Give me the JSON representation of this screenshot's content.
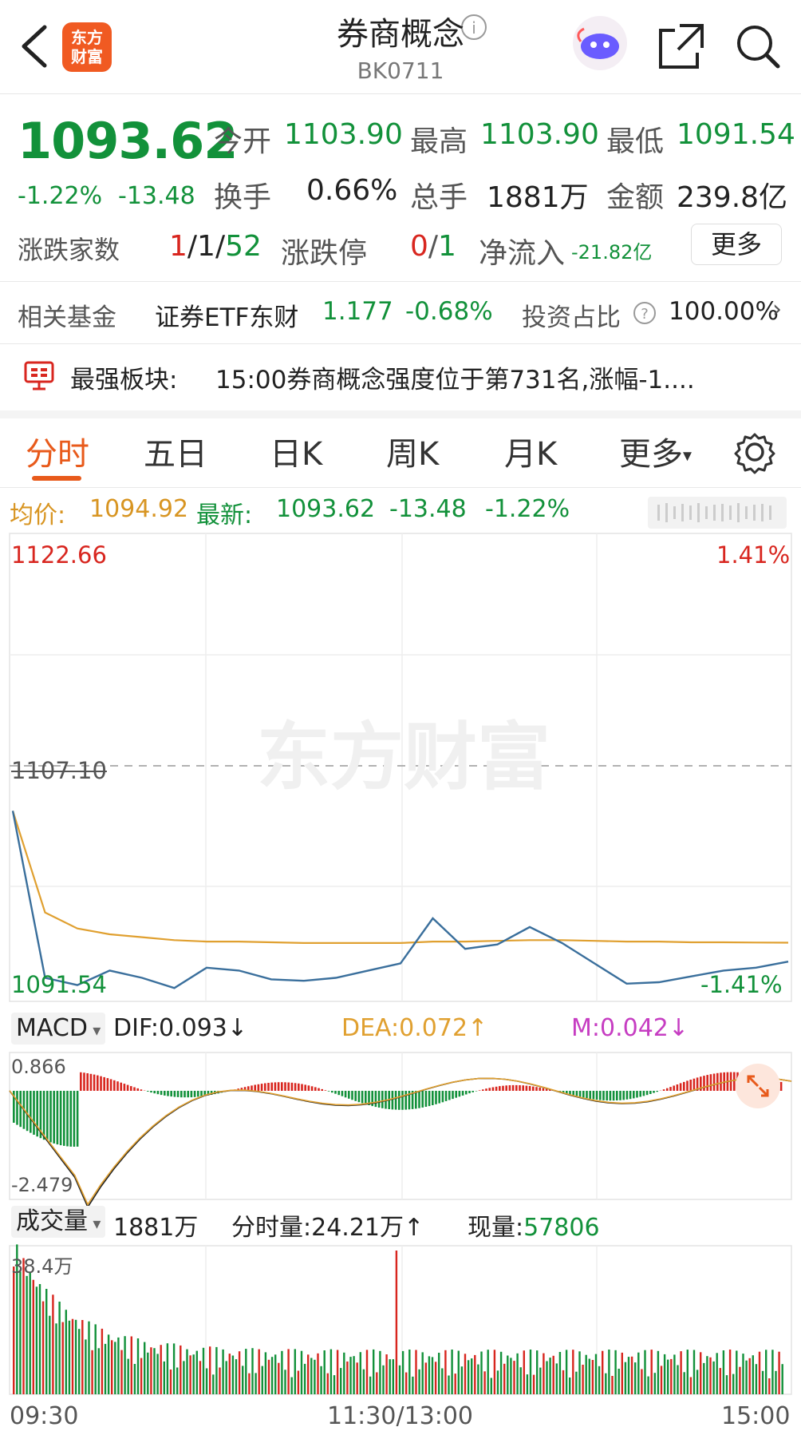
{
  "header": {
    "title": "券商概念",
    "code": "BK0711",
    "logo_text": "东方\n财富",
    "logo_line1": "东方",
    "logo_line2": "财富",
    "icons": [
      "back-icon",
      "info-icon",
      "robot-icon",
      "share-icon",
      "search-icon"
    ]
  },
  "quote": {
    "price": "1093.62",
    "change_pct": "-1.22%",
    "change": "-13.48",
    "open_label": "今开",
    "open": "1103.90",
    "high_label": "最高",
    "high": "1103.90",
    "low_label": "最低",
    "low": "1091.54",
    "turnover_label": "换手",
    "turnover": "0.66%",
    "volume_label": "总手",
    "volume": "1881万",
    "amount_label": "金额",
    "amount": "239.8亿",
    "breadth_label": "涨跌家数",
    "breadth_up": "1",
    "breadth_flat": "1",
    "breadth_down": "52",
    "limit_label": "涨跌停",
    "limit_up": "0",
    "limit_down": "1",
    "netflow_label": "净流入",
    "netflow": "-21.82亿",
    "more_label": "更多"
  },
  "fund": {
    "label": "相关基金",
    "name": "证券ETF东财",
    "price": "1.177",
    "change": "-0.68%",
    "ratio_label": "投资占比",
    "ratio": "100.00%"
  },
  "notice": {
    "prefix": "最强板块:",
    "text": "15:00券商概念强度位于第731名,涨幅-1...."
  },
  "tabs": [
    "分时",
    "五日",
    "日K",
    "周K",
    "月K",
    "更多"
  ],
  "active_tab": "分时",
  "infobar": {
    "avg_label": "均价:",
    "avg": "1094.92",
    "last_label": "最新:",
    "last": "1093.62",
    "change": "-13.48",
    "change_pct": "-1.22%"
  },
  "price_axis": {
    "top": "1122.66",
    "mid": "1107.10",
    "bottom": "1091.54",
    "top_pct": "1.41%",
    "bottom_pct": "-1.41%"
  },
  "watermark": "东方财富",
  "macd": {
    "selector": "MACD",
    "dif_label": "DIF:0.093",
    "dif_arrow": "↓",
    "dea_label": "DEA:0.072",
    "dea_arrow": "↑",
    "m_label": "M:0.042",
    "m_arrow": "↓",
    "axis_top": "0.866",
    "axis_bottom": "-2.479"
  },
  "volume": {
    "selector": "成交量",
    "total": "1881万",
    "tick_label": "分时量:24.21万",
    "tick_arrow": "↑",
    "now_label": "现量:",
    "now": "57806",
    "axis_top": "38.4万"
  },
  "time_axis": [
    "09:30",
    "11:30/13:00",
    "15:00"
  ],
  "colors": {
    "up": "#d8261f",
    "down": "#12913a",
    "accent": "#e85a1b",
    "price_line": "#3a6f9c",
    "avg_line": "#e0a030"
  },
  "chart_data": {
    "type": "line",
    "x": [
      0,
      10,
      20,
      30,
      40,
      50,
      60,
      70,
      80,
      90,
      100,
      110,
      120,
      130,
      140,
      150,
      160,
      170,
      180,
      190,
      200,
      210,
      220,
      230,
      240
    ],
    "xlabel": "",
    "ylabel": "",
    "ylim": [
      1091.54,
      1122.66
    ],
    "series": [
      {
        "values": [
          1104.0,
          1092.5,
          1092.0,
          1093.0,
          1092.5,
          1091.8,
          1093.2,
          1093.0,
          1092.4,
          1092.3,
          1092.5,
          1093.0,
          1093.5,
          1096.6,
          1094.5,
          1094.8,
          1096.0,
          1094.9,
          1093.5,
          1092.1,
          1092.2,
          1092.6,
          1093.0,
          1093.2,
          1093.62
        ]
      },
      {
        "values": [
          1104.0,
          1097.0,
          1095.9,
          1095.5,
          1095.3,
          1095.1,
          1095.0,
          1095.0,
          1094.95,
          1094.9,
          1094.9,
          1094.9,
          1094.9,
          1095.0,
          1095.0,
          1095.05,
          1095.1,
          1095.1,
          1095.05,
          1095.0,
          1095.0,
          1094.95,
          1094.95,
          1094.93,
          1094.92
        ]
      }
    ]
  }
}
